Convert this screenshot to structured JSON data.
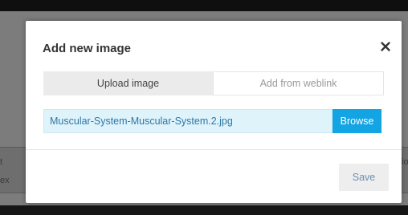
{
  "background_page": {
    "fragment_left_1": "t",
    "fragment_left_2": "ex",
    "fragment_right_1": "io"
  },
  "dialog": {
    "title": "Add new image",
    "close_icon": "close-icon",
    "tabs": [
      {
        "label": "Upload image",
        "active": true
      },
      {
        "label": "Add from weblink",
        "active": false
      }
    ],
    "file_input": {
      "value": "Muscular-System-Muscular-System.2.jpg"
    },
    "browse_label": "Browse",
    "save_label": "Save"
  },
  "colors": {
    "accent": "#13a4e3",
    "file_input_bg": "#dff3fb",
    "file_text": "#2e77a6",
    "save_text": "#6a8fb0"
  }
}
